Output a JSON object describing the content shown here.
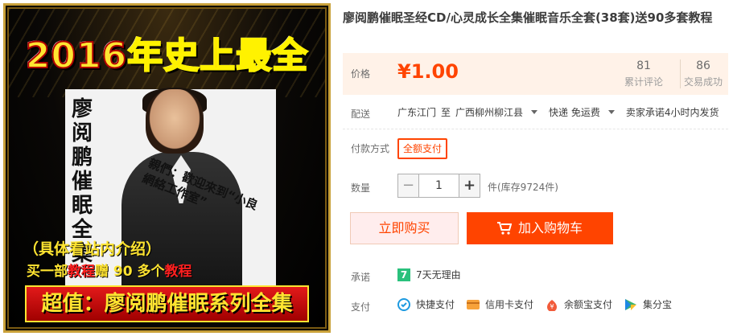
{
  "gallery": {
    "headline_year": "2016",
    "headline_rest": "年史上最全",
    "poster_vertical": "廖阅鹏催眠全集",
    "poster_scrawl": "親們：歡迎來到“小良網絡工作室”",
    "tag_intro": "（具体看站内介绍）",
    "tag_gift_prefix": "买一部",
    "tag_gift_hl1": "教程",
    "tag_gift_mid": "赠 90 多个",
    "tag_gift_hl2": "教程",
    "banner": "超值：廖阅鹏催眠系列全集"
  },
  "product": {
    "title": "廖阅鹏催眠圣经CD/心灵成长全集催眠音乐全套(38套)送90多套教程"
  },
  "price": {
    "label": "价格",
    "value": "¥1.00",
    "reviews_count": "81",
    "reviews_label": "累计评论",
    "sales_count": "86",
    "sales_label": "交易成功"
  },
  "shipping": {
    "label": "配送",
    "from": "广东江门",
    "to_word": "至",
    "to": "广西柳州柳江县",
    "express": "快递 免运费",
    "promise": "卖家承诺4小时内发货"
  },
  "payment_method": {
    "label": "付款方式",
    "option": "全额支付"
  },
  "quantity": {
    "label": "数量",
    "minus": "−",
    "value": "1",
    "plus": "+",
    "stock": "件(库存9724件)"
  },
  "actions": {
    "buy_now": "立即购买",
    "add_to_cart": "加入购物车"
  },
  "guarantee": {
    "label": "承诺",
    "badge": "7",
    "text": "7天无理由"
  },
  "pay": {
    "label": "支付",
    "items": [
      {
        "label": "快捷支付",
        "icon": "quick-pay-icon"
      },
      {
        "label": "信用卡支付",
        "icon": "credit-card-icon"
      },
      {
        "label": "余额宝支付",
        "icon": "yuebao-icon"
      },
      {
        "label": "集分宝",
        "icon": "jifenbao-icon"
      }
    ]
  },
  "colors": {
    "accent": "#ff4400",
    "price_bg": "#fff2e8",
    "guarantee_green": "#2ac17c"
  }
}
